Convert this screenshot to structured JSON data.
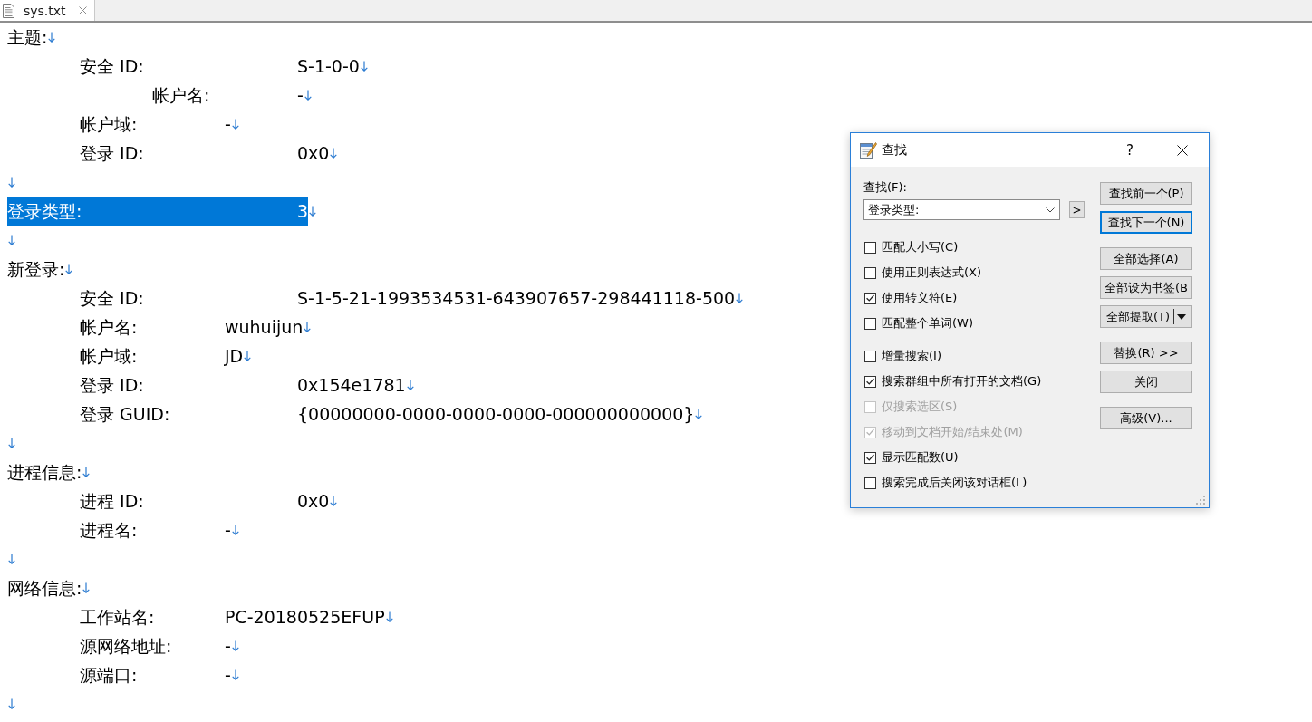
{
  "tabs": [
    {
      "title": "sys.txt",
      "selected": true
    }
  ],
  "editor": {
    "lines": [
      {
        "kind": "heading",
        "label": "主题:",
        "selected": false
      },
      {
        "kind": "field",
        "label": "安全 ID:",
        "value": "S-1-0-0",
        "selected": false
      },
      {
        "kind": "field-deep",
        "label": "帐户名:",
        "value": "-",
        "selected": false
      },
      {
        "kind": "field-near",
        "label": "帐户域:",
        "value": "-",
        "selected": false
      },
      {
        "kind": "field",
        "label": "登录 ID:",
        "value": "0x0",
        "selected": false
      },
      {
        "kind": "blank",
        "selected": false
      },
      {
        "kind": "field-top",
        "label": "登录类型:",
        "value": "3",
        "selected": true
      },
      {
        "kind": "blank",
        "selected": false
      },
      {
        "kind": "heading",
        "label": "新登录:",
        "selected": false
      },
      {
        "kind": "field",
        "label": "安全 ID:",
        "value": "S-1-5-21-1993534531-643907657-298441118-500",
        "selected": false
      },
      {
        "kind": "field-near",
        "label": "帐户名:",
        "value": "wuhuijun",
        "selected": false
      },
      {
        "kind": "field-near",
        "label": "帐户域:",
        "value": "JD",
        "selected": false
      },
      {
        "kind": "field",
        "label": "登录 ID:",
        "value": "0x154e1781",
        "selected": false
      },
      {
        "kind": "field",
        "label": "登录 GUID:",
        "value": "{00000000-0000-0000-0000-000000000000}",
        "selected": false
      },
      {
        "kind": "blank",
        "selected": false
      },
      {
        "kind": "heading",
        "label": "进程信息:",
        "selected": false
      },
      {
        "kind": "field",
        "label": "进程 ID:",
        "value": "0x0",
        "selected": false
      },
      {
        "kind": "field-near",
        "label": "进程名:",
        "value": "-",
        "selected": false
      },
      {
        "kind": "blank",
        "selected": false
      },
      {
        "kind": "heading",
        "label": "网络信息:",
        "selected": false
      },
      {
        "kind": "field-near",
        "label": "工作站名:",
        "value": "PC-20180525EFUP",
        "selected": false
      },
      {
        "kind": "field-near",
        "label": "源网络地址:",
        "value": "-",
        "selected": false
      },
      {
        "kind": "field-near",
        "label": "源端口:",
        "value": "-",
        "selected": false
      },
      {
        "kind": "blank",
        "selected": false
      }
    ]
  },
  "find_dialog": {
    "title": "查找",
    "help_button": "?",
    "find_label": "查找(F):",
    "find_value": "登录类型:",
    "menu_button": ">",
    "option_groups": [
      [
        {
          "label": "匹配大小写(C)",
          "checked": false,
          "disabled": false
        },
        {
          "label": "使用正则表达式(X)",
          "checked": false,
          "disabled": false
        },
        {
          "label": "使用转义符(E)",
          "checked": true,
          "disabled": false
        },
        {
          "label": "匹配整个单词(W)",
          "checked": false,
          "disabled": false
        }
      ],
      [
        {
          "label": "增量搜索(I)",
          "checked": false,
          "disabled": false
        },
        {
          "label": "搜索群组中所有打开的文档(G)",
          "checked": true,
          "disabled": false
        },
        {
          "label": "仅搜索选区(S)",
          "checked": false,
          "disabled": true
        },
        {
          "label": "移动到文档开始/结束处(M)",
          "checked": true,
          "disabled": true
        },
        {
          "label": "显示匹配数(U)",
          "checked": true,
          "disabled": false
        },
        {
          "label": "搜索完成后关闭该对话框(L)",
          "checked": false,
          "disabled": false
        }
      ]
    ],
    "button_groups": [
      [
        {
          "kind": "push",
          "label": "查找前一个(P)",
          "focused": false
        },
        {
          "kind": "push",
          "label": "查找下一个(N)",
          "focused": true
        }
      ],
      [
        {
          "kind": "push",
          "label": "全部选择(A)",
          "focused": false
        },
        {
          "kind": "push",
          "label": "全部设为书签(B",
          "focused": false
        },
        {
          "kind": "split",
          "label": "全部提取(T)",
          "focused": false
        }
      ],
      [
        {
          "kind": "push",
          "label": "替换(R) >>",
          "focused": false
        },
        {
          "kind": "push",
          "label": "关闭",
          "focused": false
        }
      ],
      [
        {
          "kind": "push",
          "label": "高级(V)...",
          "focused": false
        }
      ]
    ]
  }
}
